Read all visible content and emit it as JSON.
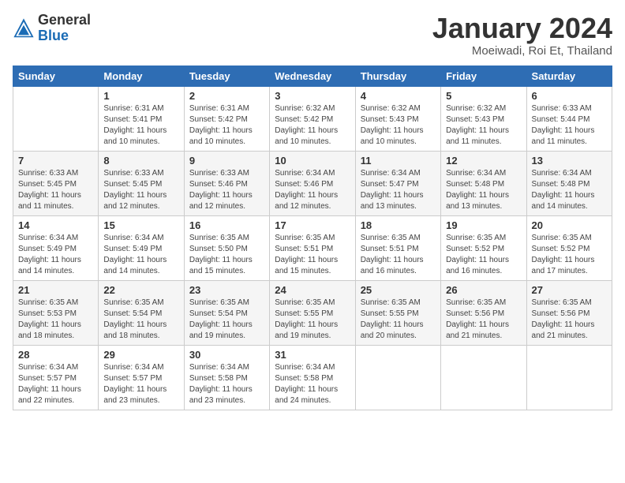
{
  "logo": {
    "general": "General",
    "blue": "Blue"
  },
  "title": "January 2024",
  "subtitle": "Moeiwadi, Roi Et, Thailand",
  "days_of_week": [
    "Sunday",
    "Monday",
    "Tuesday",
    "Wednesday",
    "Thursday",
    "Friday",
    "Saturday"
  ],
  "weeks": [
    [
      {
        "day": "",
        "sunrise": "",
        "sunset": "",
        "daylight": ""
      },
      {
        "day": "1",
        "sunrise": "Sunrise: 6:31 AM",
        "sunset": "Sunset: 5:41 PM",
        "daylight": "Daylight: 11 hours and 10 minutes."
      },
      {
        "day": "2",
        "sunrise": "Sunrise: 6:31 AM",
        "sunset": "Sunset: 5:42 PM",
        "daylight": "Daylight: 11 hours and 10 minutes."
      },
      {
        "day": "3",
        "sunrise": "Sunrise: 6:32 AM",
        "sunset": "Sunset: 5:42 PM",
        "daylight": "Daylight: 11 hours and 10 minutes."
      },
      {
        "day": "4",
        "sunrise": "Sunrise: 6:32 AM",
        "sunset": "Sunset: 5:43 PM",
        "daylight": "Daylight: 11 hours and 10 minutes."
      },
      {
        "day": "5",
        "sunrise": "Sunrise: 6:32 AM",
        "sunset": "Sunset: 5:43 PM",
        "daylight": "Daylight: 11 hours and 11 minutes."
      },
      {
        "day": "6",
        "sunrise": "Sunrise: 6:33 AM",
        "sunset": "Sunset: 5:44 PM",
        "daylight": "Daylight: 11 hours and 11 minutes."
      }
    ],
    [
      {
        "day": "7",
        "sunrise": "Sunrise: 6:33 AM",
        "sunset": "Sunset: 5:45 PM",
        "daylight": "Daylight: 11 hours and 11 minutes."
      },
      {
        "day": "8",
        "sunrise": "Sunrise: 6:33 AM",
        "sunset": "Sunset: 5:45 PM",
        "daylight": "Daylight: 11 hours and 12 minutes."
      },
      {
        "day": "9",
        "sunrise": "Sunrise: 6:33 AM",
        "sunset": "Sunset: 5:46 PM",
        "daylight": "Daylight: 11 hours and 12 minutes."
      },
      {
        "day": "10",
        "sunrise": "Sunrise: 6:34 AM",
        "sunset": "Sunset: 5:46 PM",
        "daylight": "Daylight: 11 hours and 12 minutes."
      },
      {
        "day": "11",
        "sunrise": "Sunrise: 6:34 AM",
        "sunset": "Sunset: 5:47 PM",
        "daylight": "Daylight: 11 hours and 13 minutes."
      },
      {
        "day": "12",
        "sunrise": "Sunrise: 6:34 AM",
        "sunset": "Sunset: 5:48 PM",
        "daylight": "Daylight: 11 hours and 13 minutes."
      },
      {
        "day": "13",
        "sunrise": "Sunrise: 6:34 AM",
        "sunset": "Sunset: 5:48 PM",
        "daylight": "Daylight: 11 hours and 14 minutes."
      }
    ],
    [
      {
        "day": "14",
        "sunrise": "Sunrise: 6:34 AM",
        "sunset": "Sunset: 5:49 PM",
        "daylight": "Daylight: 11 hours and 14 minutes."
      },
      {
        "day": "15",
        "sunrise": "Sunrise: 6:34 AM",
        "sunset": "Sunset: 5:49 PM",
        "daylight": "Daylight: 11 hours and 14 minutes."
      },
      {
        "day": "16",
        "sunrise": "Sunrise: 6:35 AM",
        "sunset": "Sunset: 5:50 PM",
        "daylight": "Daylight: 11 hours and 15 minutes."
      },
      {
        "day": "17",
        "sunrise": "Sunrise: 6:35 AM",
        "sunset": "Sunset: 5:51 PM",
        "daylight": "Daylight: 11 hours and 15 minutes."
      },
      {
        "day": "18",
        "sunrise": "Sunrise: 6:35 AM",
        "sunset": "Sunset: 5:51 PM",
        "daylight": "Daylight: 11 hours and 16 minutes."
      },
      {
        "day": "19",
        "sunrise": "Sunrise: 6:35 AM",
        "sunset": "Sunset: 5:52 PM",
        "daylight": "Daylight: 11 hours and 16 minutes."
      },
      {
        "day": "20",
        "sunrise": "Sunrise: 6:35 AM",
        "sunset": "Sunset: 5:52 PM",
        "daylight": "Daylight: 11 hours and 17 minutes."
      }
    ],
    [
      {
        "day": "21",
        "sunrise": "Sunrise: 6:35 AM",
        "sunset": "Sunset: 5:53 PM",
        "daylight": "Daylight: 11 hours and 18 minutes."
      },
      {
        "day": "22",
        "sunrise": "Sunrise: 6:35 AM",
        "sunset": "Sunset: 5:54 PM",
        "daylight": "Daylight: 11 hours and 18 minutes."
      },
      {
        "day": "23",
        "sunrise": "Sunrise: 6:35 AM",
        "sunset": "Sunset: 5:54 PM",
        "daylight": "Daylight: 11 hours and 19 minutes."
      },
      {
        "day": "24",
        "sunrise": "Sunrise: 6:35 AM",
        "sunset": "Sunset: 5:55 PM",
        "daylight": "Daylight: 11 hours and 19 minutes."
      },
      {
        "day": "25",
        "sunrise": "Sunrise: 6:35 AM",
        "sunset": "Sunset: 5:55 PM",
        "daylight": "Daylight: 11 hours and 20 minutes."
      },
      {
        "day": "26",
        "sunrise": "Sunrise: 6:35 AM",
        "sunset": "Sunset: 5:56 PM",
        "daylight": "Daylight: 11 hours and 21 minutes."
      },
      {
        "day": "27",
        "sunrise": "Sunrise: 6:35 AM",
        "sunset": "Sunset: 5:56 PM",
        "daylight": "Daylight: 11 hours and 21 minutes."
      }
    ],
    [
      {
        "day": "28",
        "sunrise": "Sunrise: 6:34 AM",
        "sunset": "Sunset: 5:57 PM",
        "daylight": "Daylight: 11 hours and 22 minutes."
      },
      {
        "day": "29",
        "sunrise": "Sunrise: 6:34 AM",
        "sunset": "Sunset: 5:57 PM",
        "daylight": "Daylight: 11 hours and 23 minutes."
      },
      {
        "day": "30",
        "sunrise": "Sunrise: 6:34 AM",
        "sunset": "Sunset: 5:58 PM",
        "daylight": "Daylight: 11 hours and 23 minutes."
      },
      {
        "day": "31",
        "sunrise": "Sunrise: 6:34 AM",
        "sunset": "Sunset: 5:58 PM",
        "daylight": "Daylight: 11 hours and 24 minutes."
      },
      {
        "day": "",
        "sunrise": "",
        "sunset": "",
        "daylight": ""
      },
      {
        "day": "",
        "sunrise": "",
        "sunset": "",
        "daylight": ""
      },
      {
        "day": "",
        "sunrise": "",
        "sunset": "",
        "daylight": ""
      }
    ]
  ]
}
